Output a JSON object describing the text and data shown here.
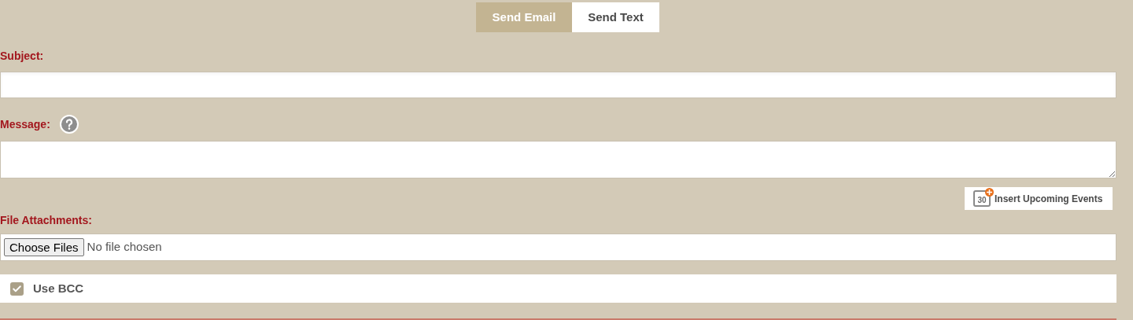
{
  "tabs": [
    {
      "label": "Send Email",
      "selected": true
    },
    {
      "label": "Send Text",
      "selected": false
    }
  ],
  "subject": {
    "label": "Subject:"
  },
  "message": {
    "label": "Message:"
  },
  "insert_button": {
    "label": "Insert Upcoming Events",
    "icon_text": "30"
  },
  "attachments": {
    "label": "File Attachments:",
    "button": "Choose Files",
    "status": "No file chosen"
  },
  "bcc": {
    "label": "Use BCC",
    "checked": true
  }
}
